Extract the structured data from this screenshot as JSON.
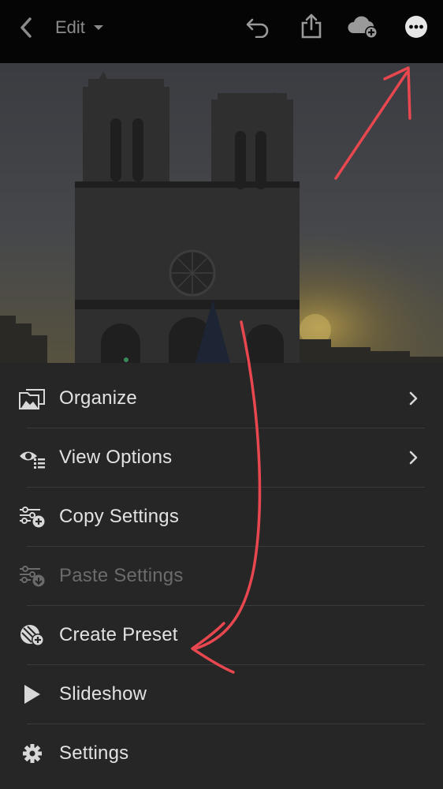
{
  "header": {
    "edit_label": "Edit",
    "icons": [
      "chevron-left-icon",
      "chevron-down-icon",
      "undo-icon",
      "share-icon",
      "cloud-add-icon",
      "more-icon"
    ]
  },
  "menu": {
    "items": [
      {
        "label": "Organize",
        "icon": "folder-images-icon",
        "has_submenu": true,
        "enabled": true
      },
      {
        "label": "View Options",
        "icon": "view-options-icon",
        "has_submenu": true,
        "enabled": true
      },
      {
        "label": "Copy Settings",
        "icon": "copy-settings-icon",
        "has_submenu": false,
        "enabled": true
      },
      {
        "label": "Paste Settings",
        "icon": "paste-settings-icon",
        "has_submenu": false,
        "enabled": false
      },
      {
        "label": "Create Preset",
        "icon": "create-preset-icon",
        "has_submenu": false,
        "enabled": true
      },
      {
        "label": "Slideshow",
        "icon": "play-icon",
        "has_submenu": false,
        "enabled": true
      },
      {
        "label": "Settings",
        "icon": "gear-icon",
        "has_submenu": false,
        "enabled": true
      }
    ]
  },
  "colors": {
    "topbar_bg": "#050505",
    "menu_bg": "#262626",
    "text": "#e2e2e2",
    "disabled_text": "#6b6b6b",
    "annotation": "#e8474f"
  }
}
